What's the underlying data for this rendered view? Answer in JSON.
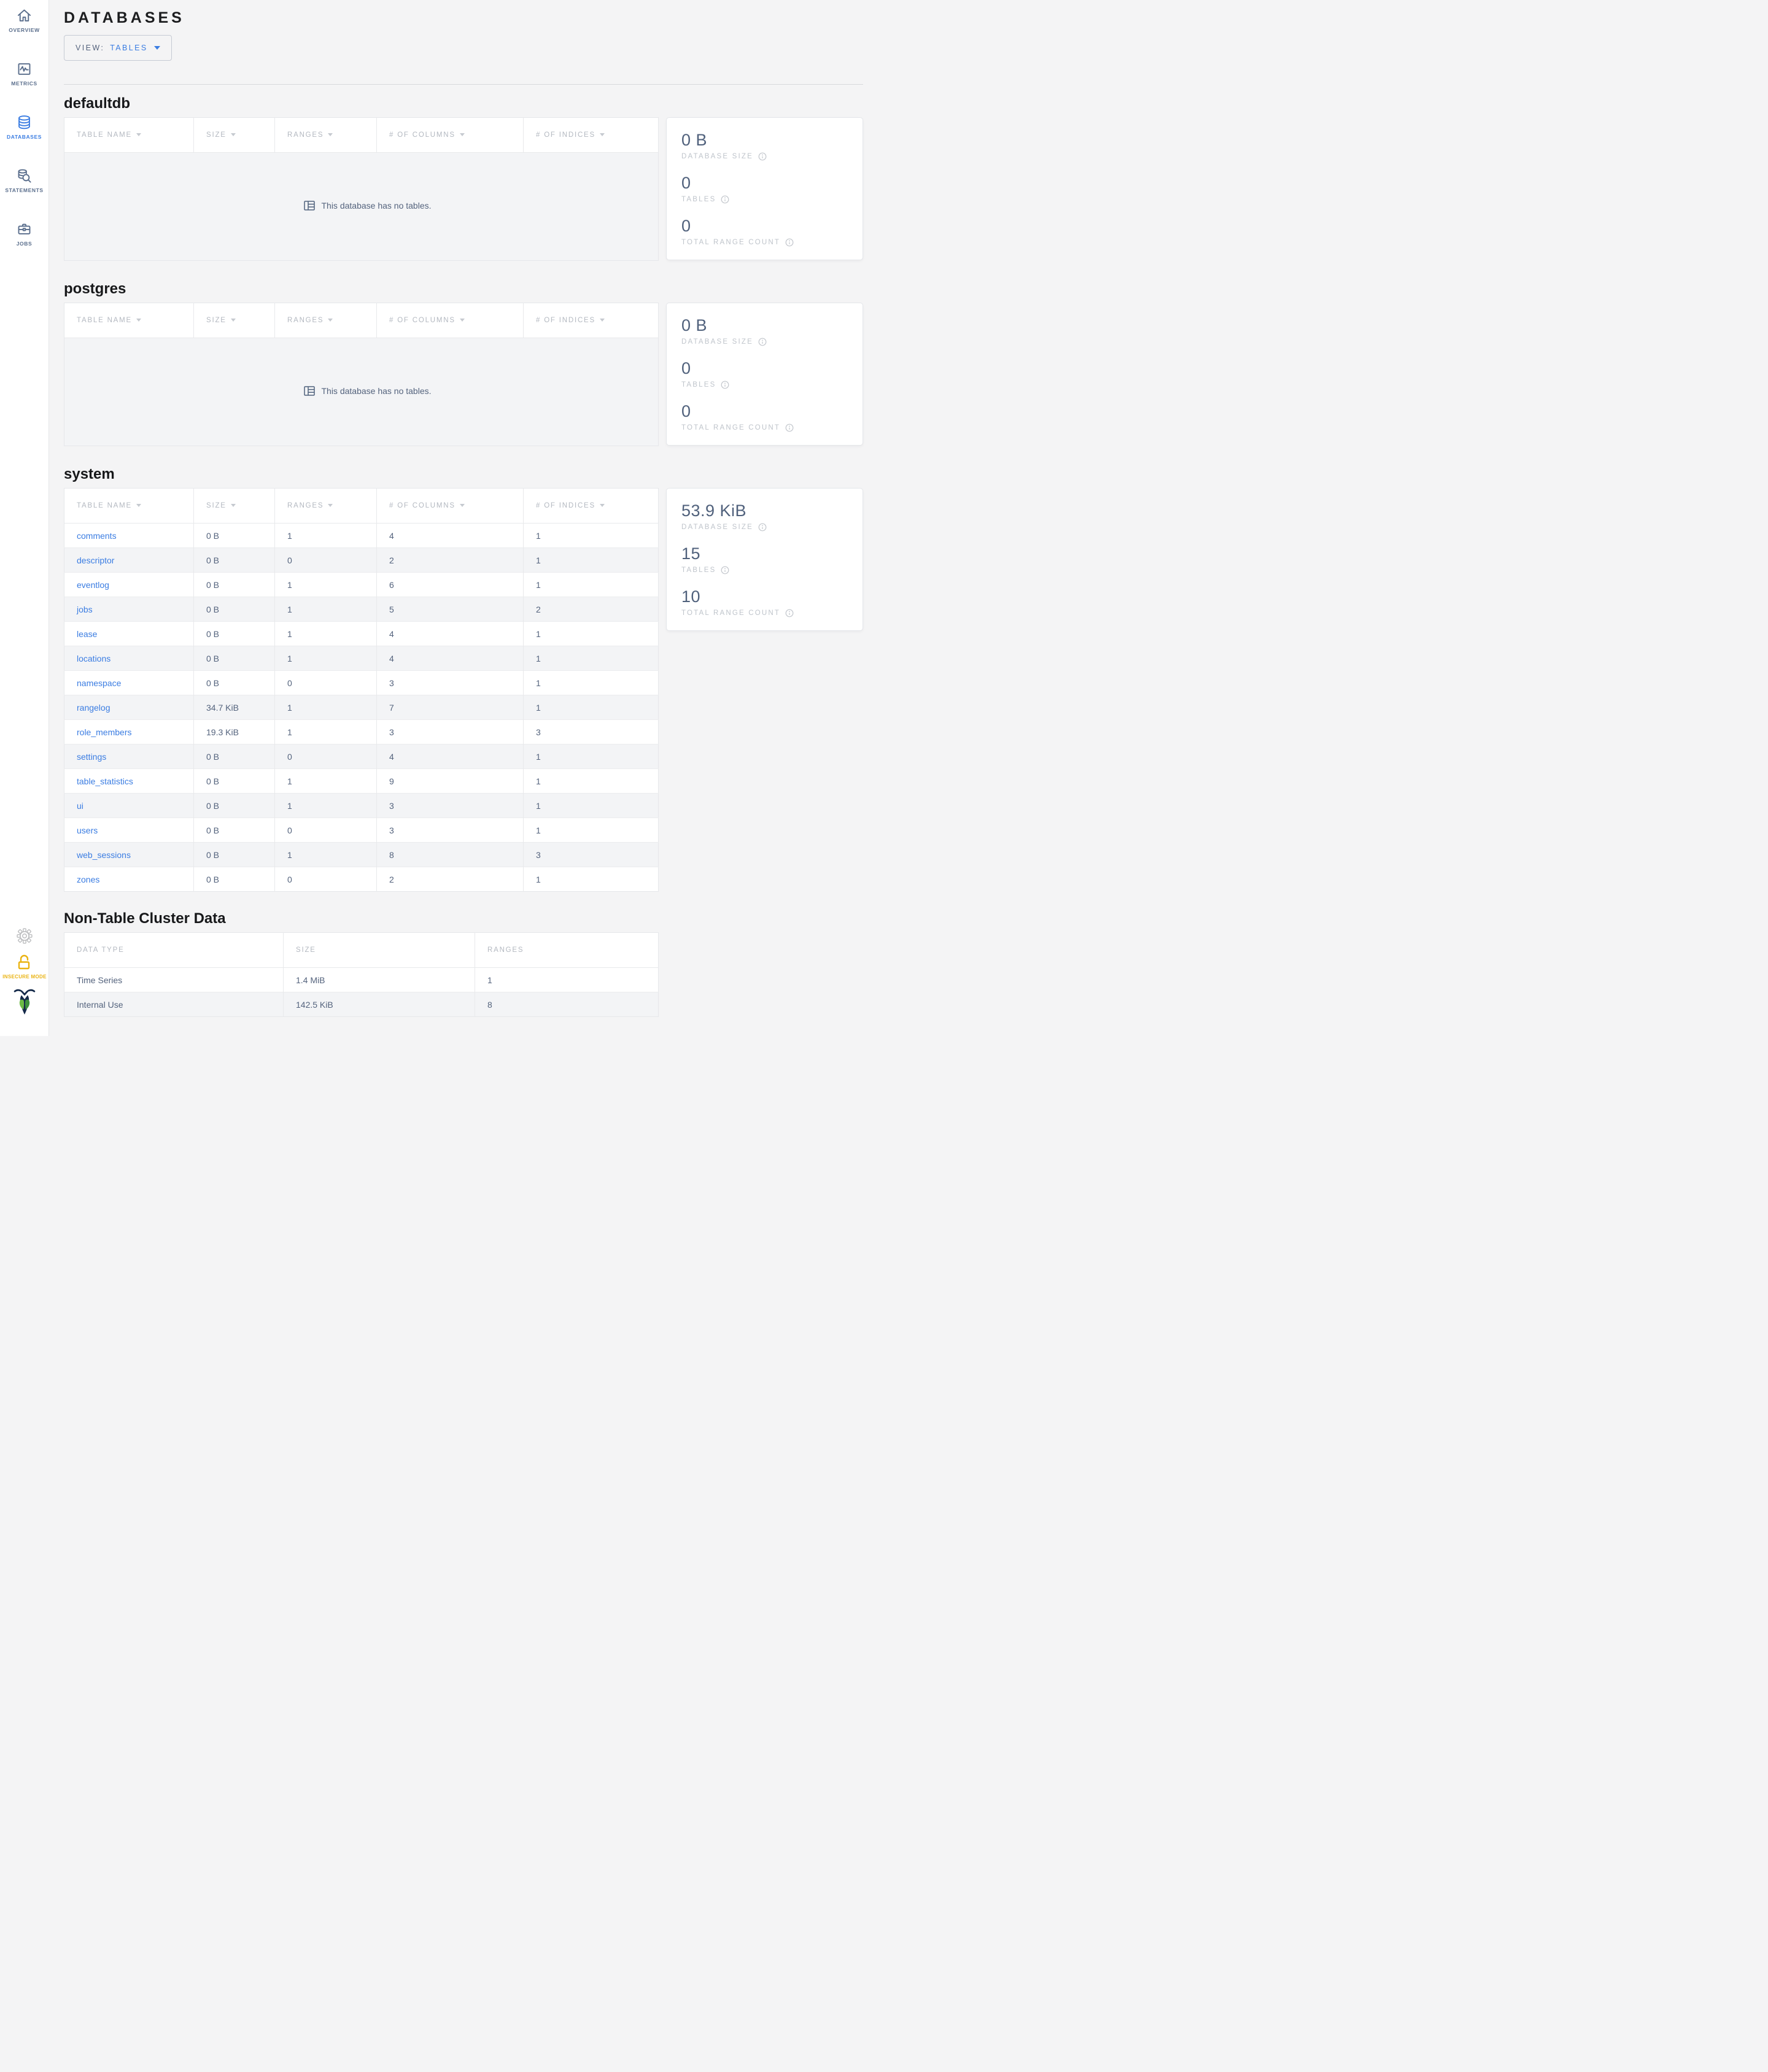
{
  "sidebar": {
    "items": [
      {
        "label": "OVERVIEW",
        "icon": "home-icon",
        "active": false
      },
      {
        "label": "METRICS",
        "icon": "metrics-icon",
        "active": false
      },
      {
        "label": "DATABASES",
        "icon": "databases-icon",
        "active": true
      },
      {
        "label": "STATEMENTS",
        "icon": "statements-icon",
        "active": false
      },
      {
        "label": "JOBS",
        "icon": "jobs-icon",
        "active": false
      }
    ],
    "insecure_label": "INSECURE MODE"
  },
  "header": {
    "title": "DATABASES",
    "view_label": "VIEW:",
    "view_value": "TABLES"
  },
  "table_columns": [
    "TABLE NAME",
    "SIZE",
    "RANGES",
    "# OF COLUMNS",
    "# OF INDICES"
  ],
  "stat_labels": {
    "size": "DATABASE SIZE",
    "tables": "TABLES",
    "ranges": "TOTAL RANGE COUNT"
  },
  "empty_message": "This database has no tables.",
  "databases": [
    {
      "name": "defaultdb",
      "stats": {
        "size": "0 B",
        "tables": "0",
        "ranges": "0"
      }
    },
    {
      "name": "postgres",
      "stats": {
        "size": "0 B",
        "tables": "0",
        "ranges": "0"
      }
    },
    {
      "name": "system",
      "stats": {
        "size": "53.9 KiB",
        "tables": "15",
        "ranges": "10"
      },
      "rows": [
        [
          "comments",
          "0 B",
          "1",
          "4",
          "1"
        ],
        [
          "descriptor",
          "0 B",
          "0",
          "2",
          "1"
        ],
        [
          "eventlog",
          "0 B",
          "1",
          "6",
          "1"
        ],
        [
          "jobs",
          "0 B",
          "1",
          "5",
          "2"
        ],
        [
          "lease",
          "0 B",
          "1",
          "4",
          "1"
        ],
        [
          "locations",
          "0 B",
          "1",
          "4",
          "1"
        ],
        [
          "namespace",
          "0 B",
          "0",
          "3",
          "1"
        ],
        [
          "rangelog",
          "34.7 KiB",
          "1",
          "7",
          "1"
        ],
        [
          "role_members",
          "19.3 KiB",
          "1",
          "3",
          "3"
        ],
        [
          "settings",
          "0 B",
          "0",
          "4",
          "1"
        ],
        [
          "table_statistics",
          "0 B",
          "1",
          "9",
          "1"
        ],
        [
          "ui",
          "0 B",
          "1",
          "3",
          "1"
        ],
        [
          "users",
          "0 B",
          "0",
          "3",
          "1"
        ],
        [
          "web_sessions",
          "0 B",
          "1",
          "8",
          "3"
        ],
        [
          "zones",
          "0 B",
          "0",
          "2",
          "1"
        ]
      ]
    }
  ],
  "non_table": {
    "title": "Non-Table Cluster Data",
    "columns": [
      "DATA TYPE",
      "SIZE",
      "RANGES"
    ],
    "rows": [
      [
        "Time Series",
        "1.4 MiB",
        "1"
      ],
      [
        "Internal Use",
        "142.5 KiB",
        "8"
      ]
    ]
  },
  "colors": {
    "accent_blue": "#3b7de2",
    "insecure_yellow": "#eab312",
    "value_slate": "#50617c",
    "logo_navy": "#152a4a",
    "logo_green_light": "#6cbb45",
    "logo_green_dark": "#3c8f3c"
  }
}
